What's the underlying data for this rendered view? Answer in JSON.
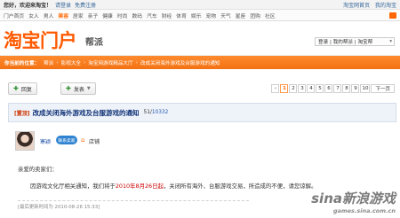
{
  "topbar": {
    "hello": "您好，欢迎来淘宝！",
    "login": "请登录",
    "register": "免费注册",
    "links": [
      "淘宝网首页",
      "我的淘宝"
    ]
  },
  "nav": {
    "items": [
      "门户首页",
      "女人",
      "男人",
      "美容",
      "居家",
      "亲子",
      "健康",
      "时尚",
      "数码",
      "汽车",
      "财经",
      "体育",
      "娱乐",
      "宠物",
      "天气",
      "星座",
      "团购",
      "社区"
    ],
    "active_index": 3
  },
  "brand": {
    "logo": "淘宝门户",
    "subtitle": "帮派",
    "login_label": "登录 | 我的帮派 | 淘宝帮"
  },
  "breadcrumbs": {
    "head": "你当前的位置：",
    "items": [
      "帮派",
      "影视大全",
      "淘宝网游戏精品大厅",
      "改成关闭海外游戏及台服游戏的通知"
    ]
  },
  "toolbar": {
    "reply": "回复",
    "post": "发表",
    "pages": [
      "1",
      "2",
      "3",
      "4",
      "5",
      "6",
      "7",
      "8",
      "9",
      "10"
    ],
    "next": "下一页"
  },
  "thread": {
    "tag": "[置顶]",
    "title": "改成关闭海外游戏及台服游戏的通知",
    "stats_left": "51/",
    "stats_right": "10332"
  },
  "author": {
    "name": "寒颖",
    "badge": "联系卖家",
    "store": "店铺"
  },
  "post": {
    "greeting": "亲爱的卖家们：",
    "text_before": "因游戏文化厅相关通知，我们将于",
    "date": "2010年8月26日起",
    "text_after": "，关闭所有海外、台服游戏交易，所造成的不便，请您谅解。"
  },
  "edit_note": "[最后更新时间为 2010-08-26 15:33]",
  "watermark": {
    "brand": "sina新浪游戏",
    "site": "games.sina.com.cn"
  }
}
